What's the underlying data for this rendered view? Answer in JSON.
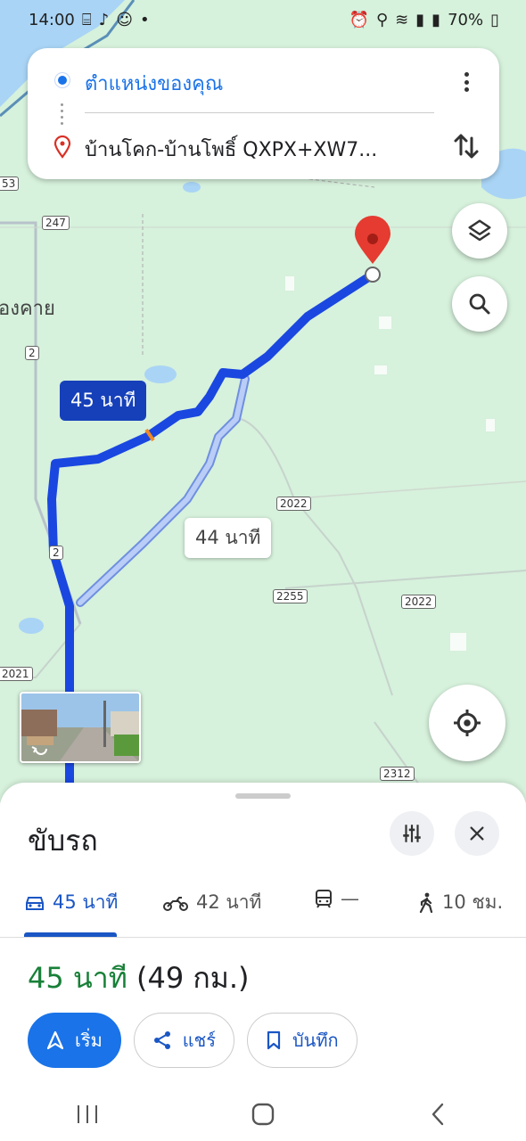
{
  "status": {
    "time": "14:00",
    "battery": "70%"
  },
  "directions": {
    "origin": "ตำแหน่งของคุณ",
    "destination": "บ้านโคก-บ้านโพธิ์ QXPX+XW7..."
  },
  "map": {
    "primary_route_label": "45 นาที",
    "alt_route_label": "44 นาที",
    "place_label": "องคาย",
    "road_shields": [
      "53",
      "247",
      "2",
      "2",
      "2021",
      "2022",
      "2255",
      "2022",
      "2312"
    ]
  },
  "sheet": {
    "title": "ขับรถ",
    "modes": [
      {
        "icon": "car-icon",
        "label": "45 นาที"
      },
      {
        "icon": "motorcycle-icon",
        "label": "42 นาที"
      },
      {
        "icon": "transit-icon",
        "label": "—"
      },
      {
        "icon": "walk-icon",
        "label": "10 ชม."
      }
    ],
    "summary_time": "45 นาที",
    "summary_distance": "(49 กม.)",
    "actions": {
      "start": "เริ่ม",
      "share": "แชร์",
      "save": "บันทึก"
    }
  },
  "colors": {
    "route": "#1a47e0",
    "alt_route": "#a8c0f5",
    "map_bg": "#d6f1dc",
    "accent": "#1a73e8"
  }
}
